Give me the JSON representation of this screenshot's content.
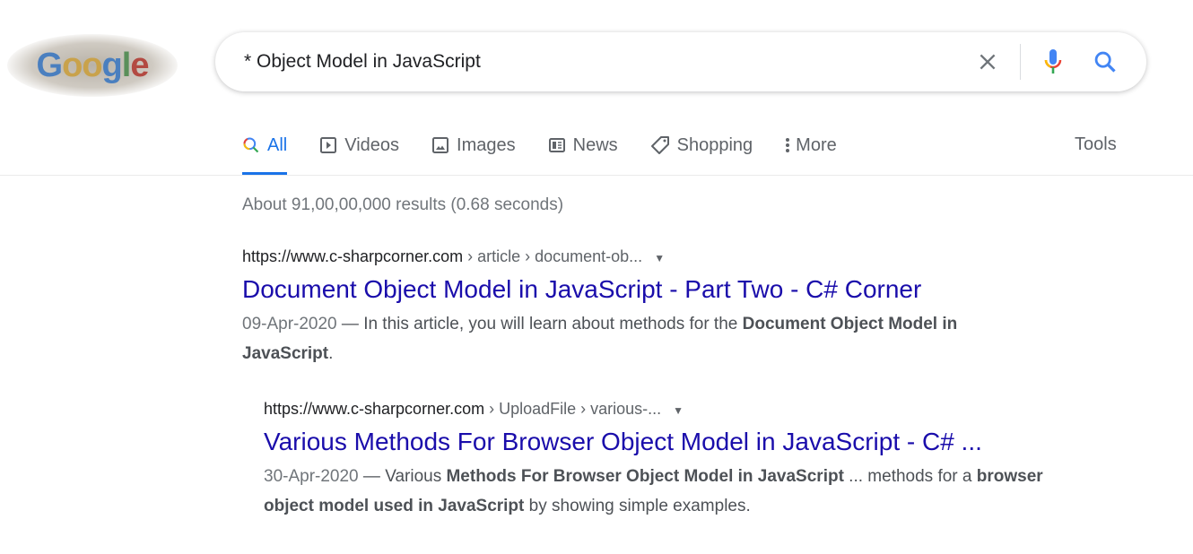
{
  "logo": {
    "text": "Google",
    "colors": [
      "#4a7fbf",
      "#c9a24b",
      "#4a7fbf",
      "#5a8f5a",
      "#b34a42"
    ]
  },
  "search": {
    "query": "* Object Model in JavaScript"
  },
  "tabs": [
    {
      "label": "All",
      "icon": "search-icon"
    },
    {
      "label": "Videos",
      "icon": "play-icon"
    },
    {
      "label": "Images",
      "icon": "image-icon"
    },
    {
      "label": "News",
      "icon": "news-icon"
    },
    {
      "label": "Shopping",
      "icon": "tag-icon"
    },
    {
      "label": "More",
      "icon": "dots-vertical-icon"
    }
  ],
  "tools": "Tools",
  "stats": "About 91,00,00,000 results (0.68 seconds)",
  "results": [
    {
      "domain": "https://www.c-sharpcorner.com",
      "path": " › article › document-ob...",
      "title": "Document Object Model in JavaScript - Part Two - C# Corner",
      "date": "09-Apr-2020",
      "sep": " — ",
      "snip1": "In this article, you will learn about methods for the ",
      "b1": "Document Object Model in JavaScript",
      "snip2": "."
    },
    {
      "domain": "https://www.c-sharpcorner.com",
      "path": " › UploadFile › various-...",
      "title": "Various Methods For Browser Object Model in JavaScript - C# ...",
      "date": "30-Apr-2020",
      "sep": " — ",
      "snip1": "Various ",
      "b1": "Methods For Browser Object Model in JavaScript",
      "snip2": " ... methods for a ",
      "b2": "browser object model used in JavaScript",
      "snip3": " by showing simple examples."
    }
  ]
}
